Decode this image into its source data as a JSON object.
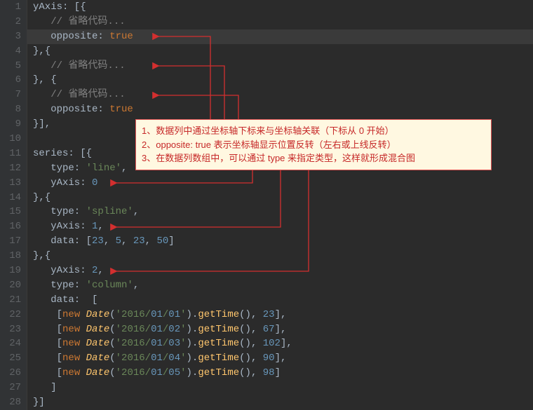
{
  "lines": [
    {
      "n": 1,
      "t": "yAxis: [{"
    },
    {
      "n": 2,
      "t": "   // 省略代码..."
    },
    {
      "n": 3,
      "t": "   opposite: true",
      "hl": true
    },
    {
      "n": 4,
      "t": "},{"
    },
    {
      "n": 5,
      "t": "   // 省略代码..."
    },
    {
      "n": 6,
      "t": "}, {"
    },
    {
      "n": 7,
      "t": "   // 省略代码..."
    },
    {
      "n": 8,
      "t": "   opposite: true"
    },
    {
      "n": 9,
      "t": "}],"
    },
    {
      "n": 10,
      "t": ""
    },
    {
      "n": 11,
      "t": "series: [{"
    },
    {
      "n": 12,
      "t": "   type: 'line',"
    },
    {
      "n": 13,
      "t": "   yAxis: 0"
    },
    {
      "n": 14,
      "t": "},{"
    },
    {
      "n": 15,
      "t": "   type: 'spline',"
    },
    {
      "n": 16,
      "t": "   yAxis: 1,"
    },
    {
      "n": 17,
      "t": "   data: [23, 5, 23, 50]"
    },
    {
      "n": 18,
      "t": "},{"
    },
    {
      "n": 19,
      "t": "   yAxis: 2,"
    },
    {
      "n": 20,
      "t": "   type: 'column',"
    },
    {
      "n": 21,
      "t": "   data:  ["
    },
    {
      "n": 22,
      "t": "    [new Date('2016/01/01').getTime(), 23],"
    },
    {
      "n": 23,
      "t": "    [new Date('2016/01/02').getTime(), 67],"
    },
    {
      "n": 24,
      "t": "    [new Date('2016/01/03').getTime(), 102],"
    },
    {
      "n": 25,
      "t": "    [new Date('2016/01/04').getTime(), 90],"
    },
    {
      "n": 26,
      "t": "    [new Date('2016/01/05').getTime(), 98]"
    },
    {
      "n": 27,
      "t": "   ]"
    },
    {
      "n": 28,
      "t": "}]"
    }
  ],
  "annotation": {
    "line1": "1、数据列中通过坐标轴下标来与坐标轴关联（下标从 0 开始）",
    "line2": "2、opposite: true 表示坐标轴显示位置反转（左右或上线反转）",
    "line3": "3、在数据列数组中，可以通过 type 来指定类型，这样就形成混合图"
  }
}
